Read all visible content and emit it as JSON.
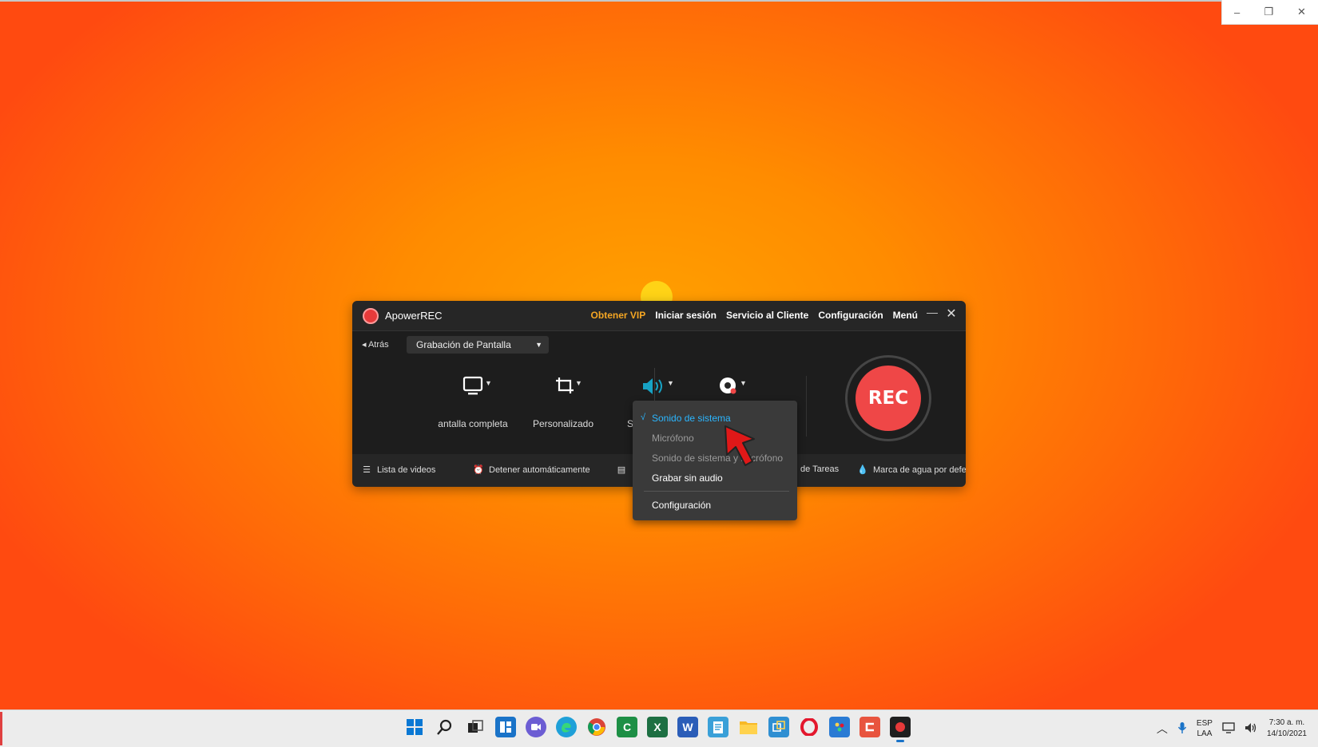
{
  "outer_window": {
    "min": "–",
    "restore": "❐",
    "close": "✕"
  },
  "app": {
    "title": "ApowerREC",
    "links": {
      "vip": "Obtener VIP",
      "login": "Iniciar sesión",
      "support": "Servicio al Cliente",
      "settings": "Configuración",
      "menu": "Menú"
    },
    "back": "◂ Atrás",
    "mode": "Grabación de Pantalla",
    "tools": {
      "fullscreen": "antalla completa",
      "custom": "Personalizado",
      "audio": "Sonido d"
    },
    "rec_label": "REC",
    "bottom": {
      "videos": "Lista de videos",
      "auto_stop": "Detener automáticamente",
      "tasks": "de Tareas",
      "watermark": "Marca de agua por defecto"
    }
  },
  "audio_menu": {
    "check": "√",
    "items": [
      "Sonido de sistema",
      "Micrófono",
      "Sonido de sistema y micrófono",
      "Grabar sin audio"
    ],
    "settings": "Configuración"
  },
  "taskbar": {
    "icons": [
      "start-icon",
      "search-icon",
      "task-view-icon",
      "widgets-icon",
      "chat-icon",
      "edge-icon",
      "chrome-icon",
      "camtasia-icon",
      "excel-icon",
      "word-icon",
      "notepad-icon",
      "explorer-icon",
      "app-icon",
      "opera-icon",
      "paint-icon",
      "snagit-icon",
      "apowerrec-icon"
    ],
    "lang_top": "ESP",
    "lang_bottom": "LAA",
    "time": "7:30 a. m.",
    "date": "14/10/2021"
  },
  "colors": {
    "accent_vip": "#f5a623",
    "rec_red": "#ef4747",
    "menu_active": "#2bb6ff"
  }
}
